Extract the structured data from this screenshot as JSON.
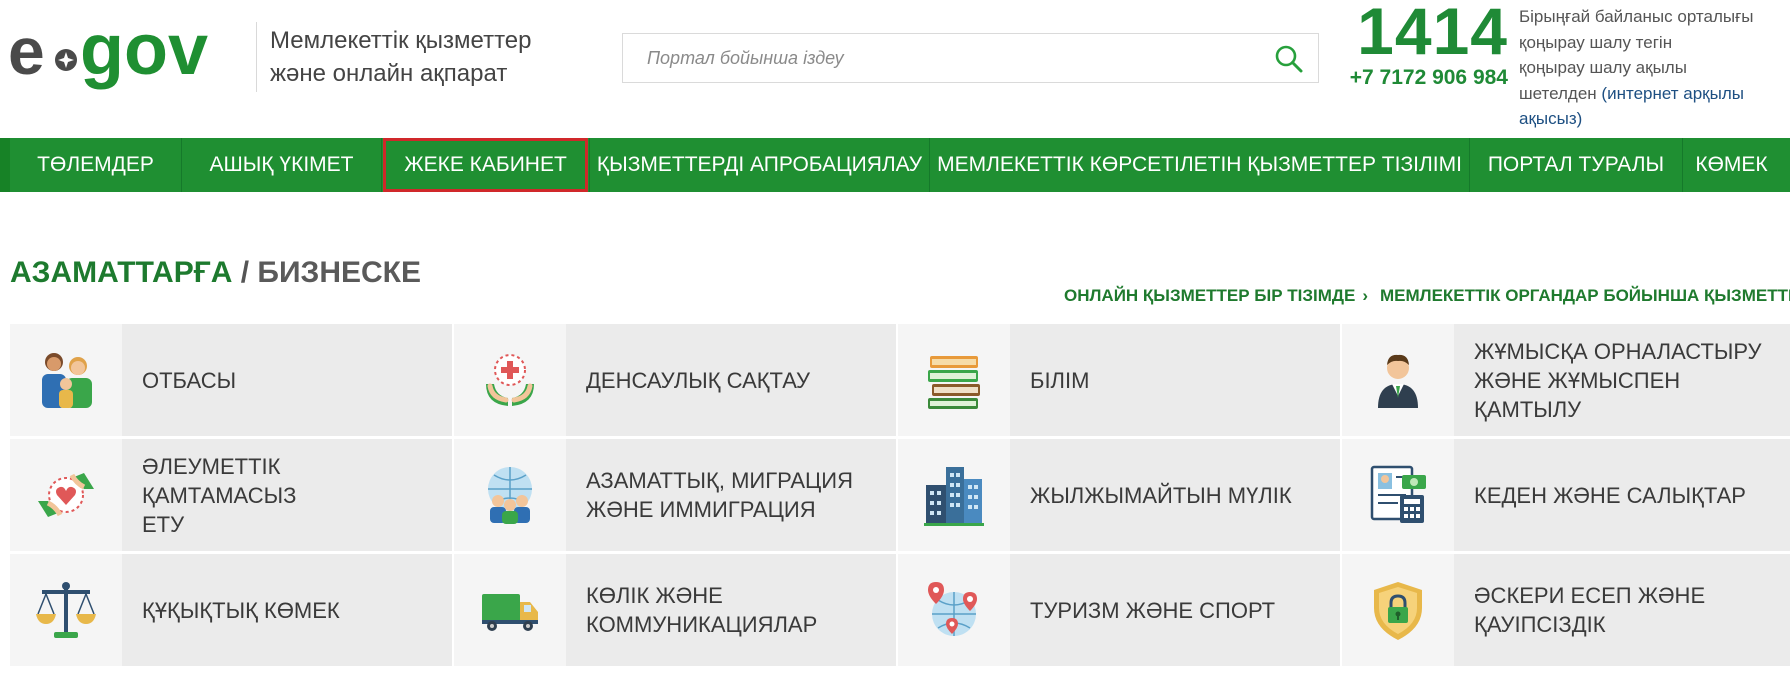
{
  "header": {
    "logo": {
      "text": "e-gov"
    },
    "tagline_line1": "Мемлекеттік қызметтер",
    "tagline_line2": "және онлайн ақпарат",
    "search": {
      "placeholder": "Портал бойынша іздеу",
      "icon": "search-icon"
    },
    "hotline": {
      "number": "1414",
      "phone": "+7 7172 906 984"
    },
    "contact": {
      "line1": "Бірыңғай байланыс орталығы",
      "line2": "қоңырау шалу тегін",
      "line3": "қоңырау шалу ақылы",
      "line4_prefix": "шетелден ",
      "line4_link": "(интернет арқылы",
      "line5_link": "ақысыз)"
    }
  },
  "nav": {
    "items": [
      {
        "label": "ТӨЛЕМДЕР"
      },
      {
        "label": "АШЫҚ ҮКІМЕТ"
      },
      {
        "label": "ЖЕКЕ КАБИНЕТ",
        "highlighted": true
      },
      {
        "label": "ҚЫЗМЕТТЕРДІ АПРОБАЦИЯЛАУ"
      },
      {
        "label": "МЕМЛЕКЕТТІК КӨРСЕТІЛЕТІН ҚЫЗМЕТТЕР ТІЗІЛІМІ"
      },
      {
        "label": "ПОРТАЛ ТУРАЛЫ"
      },
      {
        "label": "КӨМЕК"
      }
    ],
    "highlight_color": "#d0282a"
  },
  "section": {
    "citizens": "АЗАМАТТАРҒА",
    "separator": " / ",
    "business": "БИЗНЕСКЕ",
    "link_services_list": "ОНЛАЙН ҚЫЗМЕТТЕР БІР ТІЗІМДЕ",
    "link_by_agency": "МЕМЛЕКЕТТІК ОРГАНДАР БОЙЫНША ҚЫЗМЕТТЕР",
    "chevron": "›"
  },
  "categories": [
    {
      "lines": [
        "ОТБАСЫ"
      ],
      "icon": "family-icon"
    },
    {
      "lines": [
        "ДЕНСАУЛЫҚ САҚТАУ"
      ],
      "icon": "health-icon"
    },
    {
      "lines": [
        "БІЛІМ"
      ],
      "icon": "books-icon"
    },
    {
      "lines": [
        "ЖҰМЫСҚА ОРНАЛАСТЫРУ",
        "ЖӘНЕ ЖҰМЫСПЕН",
        "ҚАМТЫЛУ"
      ],
      "icon": "employee-icon"
    },
    {
      "lines": [
        "ӘЛЕУМЕТТІК ҚАМТАМАСЫЗ",
        "ЕТУ"
      ],
      "icon": "social-care-icon"
    },
    {
      "lines": [
        "АЗАМАТТЫҚ, МИГРАЦИЯ",
        "ЖӘНЕ ИММИГРАЦИЯ"
      ],
      "icon": "globe-people-icon"
    },
    {
      "lines": [
        "ЖЫЛЖЫМАЙТЫН МҮЛІК"
      ],
      "icon": "buildings-icon"
    },
    {
      "lines": [
        "КЕДЕН ЖӘНЕ САЛЫҚТАР"
      ],
      "icon": "tax-document-icon"
    },
    {
      "lines": [
        "ҚҰҚЫҚТЫҚ КӨМЕК"
      ],
      "icon": "scales-icon"
    },
    {
      "lines": [
        "КӨЛІК ЖӘНЕ",
        "КОММУНИКАЦИЯЛАР"
      ],
      "icon": "truck-icon"
    },
    {
      "lines": [
        "ТУРИЗМ ЖӘНЕ СПОРТ"
      ],
      "icon": "globe-pins-icon"
    },
    {
      "lines": [
        "ӘСКЕРИ ЕСЕП ЖӘНЕ",
        "ҚАУІПСІЗДІК"
      ],
      "icon": "shield-lock-icon"
    }
  ],
  "colors": {
    "brand_green": "#1f8f32",
    "text_green": "#1d7a2e",
    "tile_bg": "#ebebeb"
  }
}
